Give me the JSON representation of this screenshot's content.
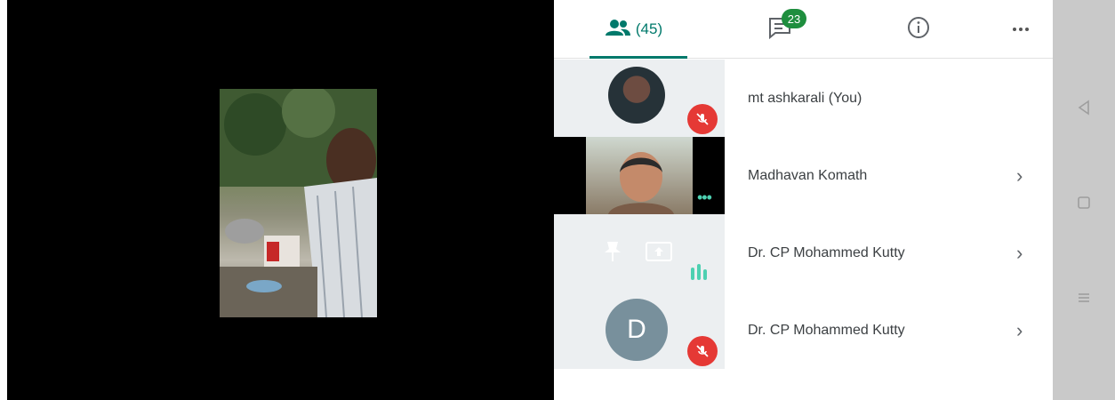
{
  "tabs": {
    "people_count": "(45)",
    "chat_badge": "23"
  },
  "participants": [
    {
      "name": "mt ashkarali (You)"
    },
    {
      "name": "Madhavan Komath"
    },
    {
      "name": "Dr. CP Mohammed Kutty"
    },
    {
      "name": "Dr. CP Mohammed Kutty",
      "avatar_letter": "D"
    }
  ],
  "icons": {
    "people": "people-icon",
    "chat": "chat-icon",
    "info": "info-icon",
    "more": "more-options-icon",
    "mic_off": "mic-off-icon",
    "pin": "pin-icon",
    "present": "present-screen-icon",
    "chevron": "chevron-right-icon",
    "back": "nav-back-icon",
    "home": "nav-home-icon",
    "recents": "nav-recents-icon"
  },
  "colors": {
    "accent": "#00796b",
    "badge": "#1e8e3e",
    "muted": "#e53935"
  }
}
